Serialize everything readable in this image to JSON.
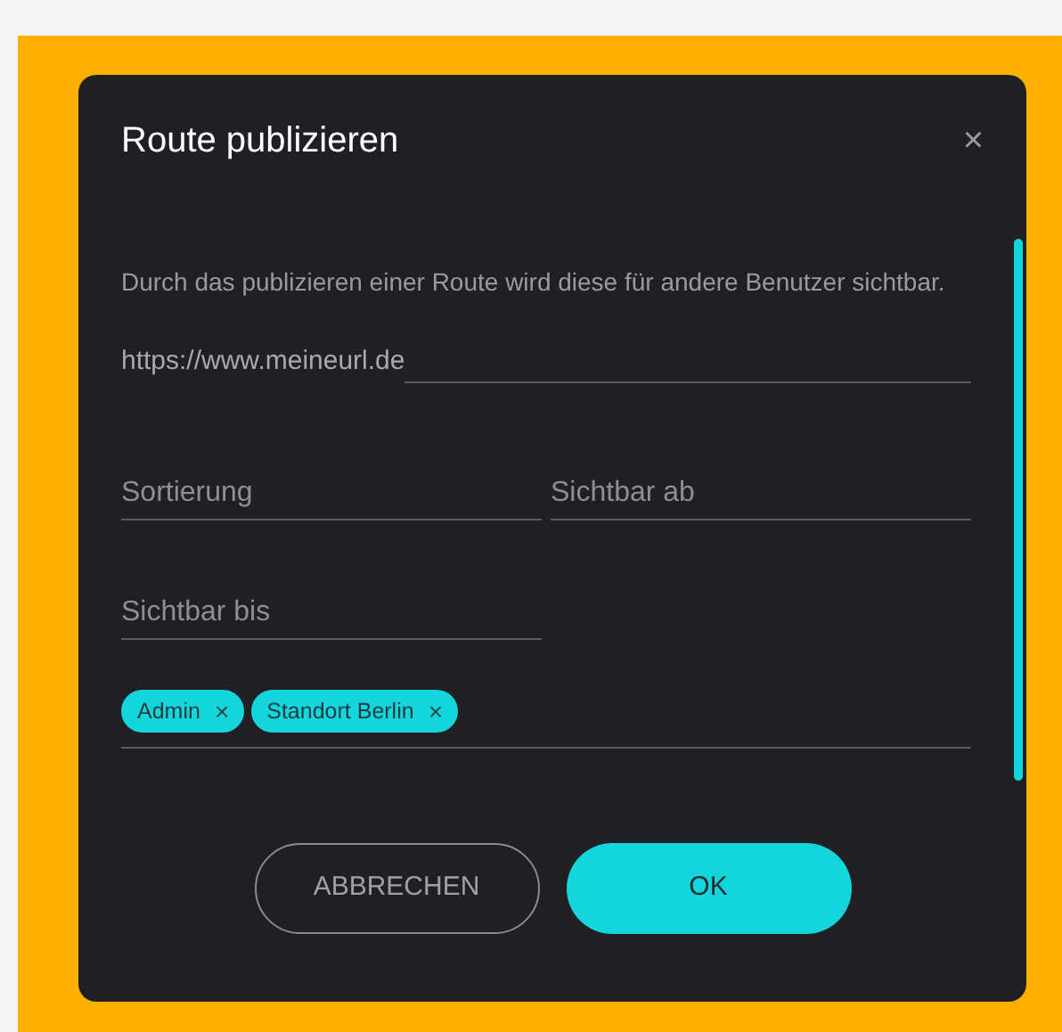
{
  "dialog": {
    "title": "Route publizieren",
    "close": "×"
  },
  "description": "Durch das publizieren einer Route wird diese für andere Benutzer sichtbar.",
  "url_prefix": "https://www.meineurl.de",
  "fields": [
    {
      "placeholder": "Sortierung"
    },
    {
      "placeholder": "Sichtbar ab"
    },
    {
      "placeholder": "Sichtbar bis"
    }
  ],
  "chips": [
    {
      "label": "Admin",
      "remove": "×"
    },
    {
      "label": "Standort Berlin",
      "remove": "×"
    }
  ],
  "buttons": [
    {
      "label": "ABBRECHEN",
      "kind": "outline"
    },
    {
      "label": "OK",
      "kind": "primary"
    }
  ]
}
